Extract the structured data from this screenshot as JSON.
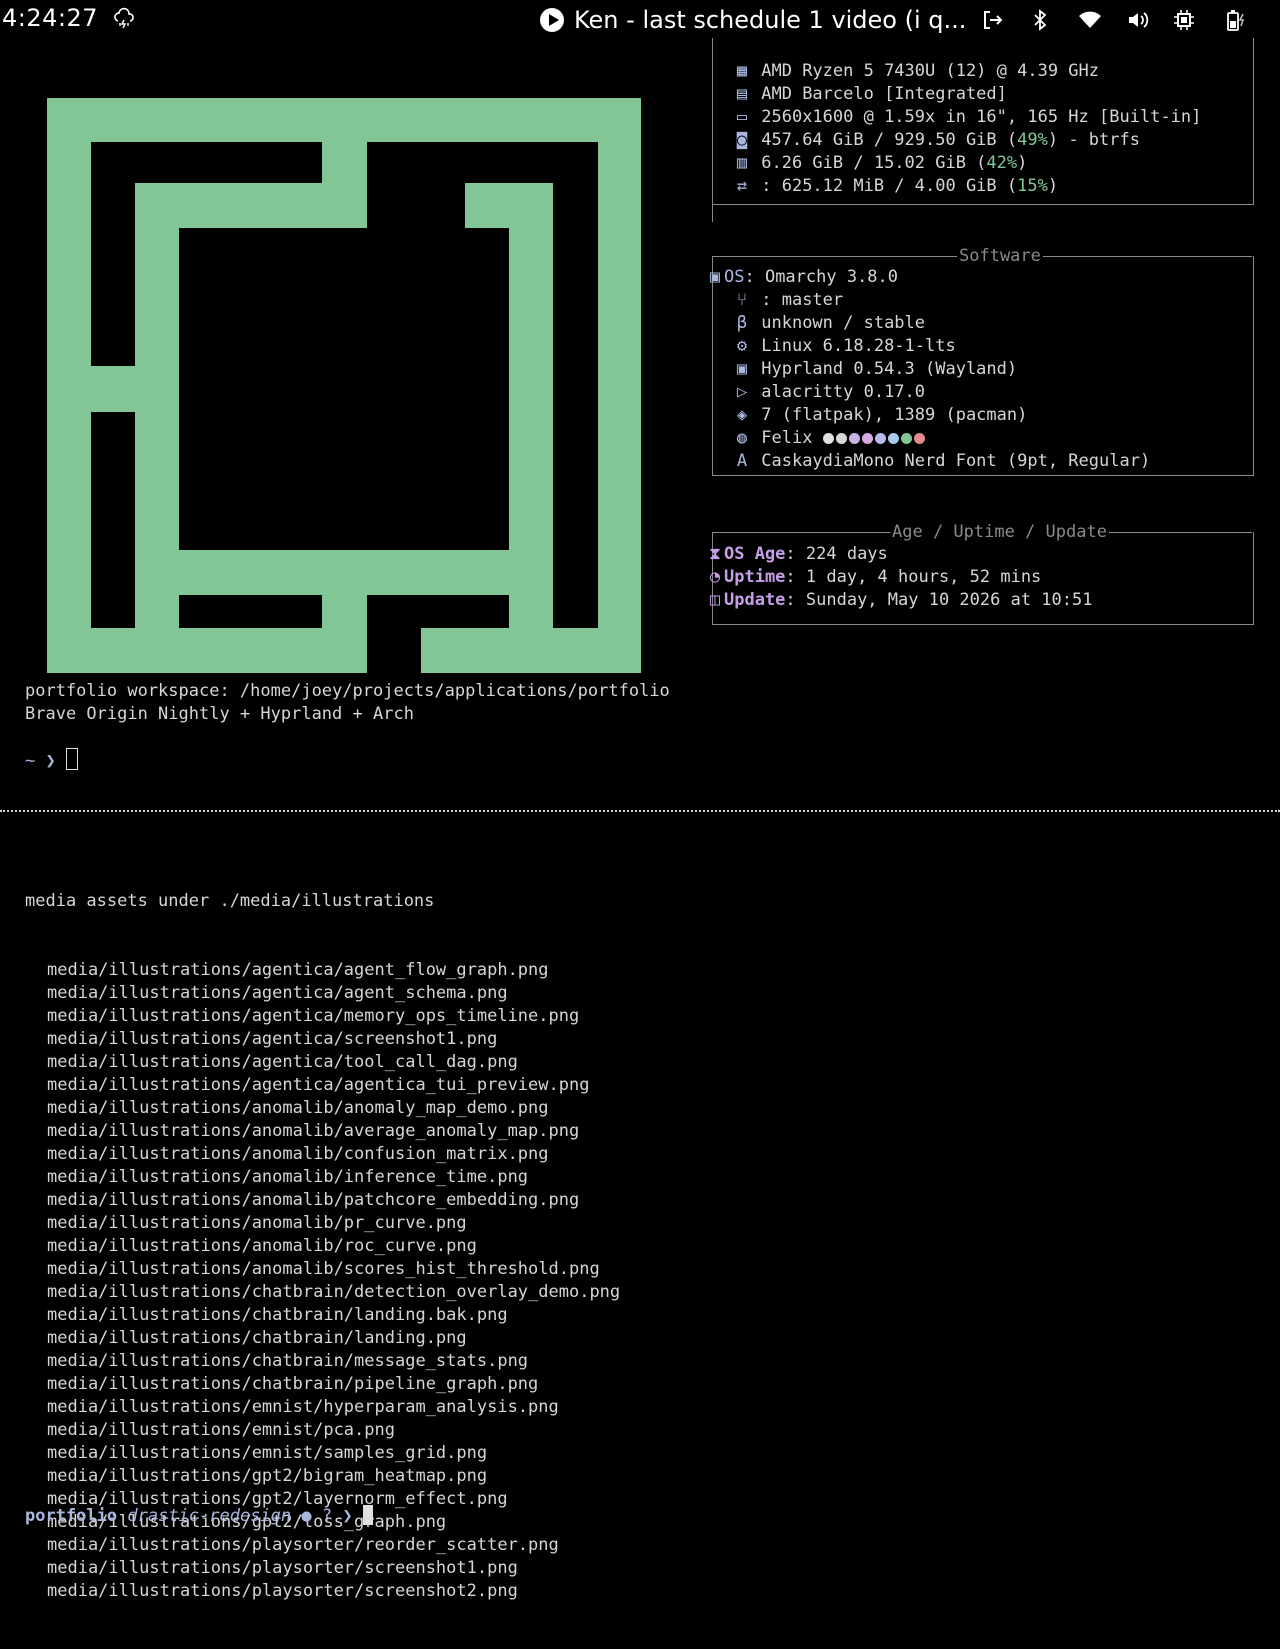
{
  "topbar": {
    "clock": "4:24:27",
    "media_title": "Ken - last schedule 1 video (i q..."
  },
  "hardware": {
    "rows": [
      {
        "icon": "cpu-icon",
        "text": "AMD Ryzen 5 7430U (12) @ 4.39 GHz"
      },
      {
        "icon": "gpu-icon",
        "text": "AMD Barcelo [Integrated]"
      },
      {
        "icon": "display-icon",
        "text": "2560x1600 @ 1.59x in 16\", 165 Hz [Built-in]"
      },
      {
        "icon": "disk-icon",
        "pre": "457.64 GiB / 929.50 GiB (",
        "pct": "49%",
        "post": ") - btrfs"
      },
      {
        "icon": "memory-icon",
        "pre": "6.26 GiB / 15.02 GiB (",
        "pct": "42%",
        "post": ")"
      },
      {
        "icon": "swap-icon",
        "pre": ": 625.12 MiB / 4.00 GiB (",
        "pct": "15%",
        "post": ")"
      }
    ]
  },
  "software": {
    "header": "Software",
    "os_label": "OS",
    "os_value": ": Omarchy 3.8.0",
    "rows": [
      {
        "icon": "git-branch-icon",
        "text": ": master"
      },
      {
        "icon": "bootloader-icon",
        "text": "unknown / stable"
      },
      {
        "icon": "kernel-gear-icon",
        "text": "Linux 6.18.28-1-lts"
      },
      {
        "icon": "window-manager-icon",
        "text": "Hyprland 0.54.3 (Wayland)"
      },
      {
        "icon": "terminal-icon",
        "text": "alacritty 0.17.0"
      },
      {
        "icon": "package-icon",
        "text": "7 (flatpak), 1389 (pacman)"
      },
      {
        "icon": "palette-icon",
        "text": "Felix"
      },
      {
        "icon": "font-icon",
        "text": "CaskaydiaMono Nerd Font (9pt, Regular)"
      }
    ],
    "palette_colors": [
      "#e0e0e0",
      "#d8d8d8",
      "#c9b4e6",
      "#d9a9e6",
      "#b9b9ef",
      "#a9c9ef",
      "#82c596",
      "#e38a8a"
    ]
  },
  "age": {
    "header": "Age / Uptime / Update",
    "rows": [
      {
        "icon": "hourglass-icon",
        "label": "OS Age",
        "value": ": 224 days"
      },
      {
        "icon": "uptime-icon",
        "label": "Uptime",
        "value": ": 1 day, 4 hours, 52 mins"
      },
      {
        "icon": "update-box-icon",
        "label": "Update",
        "value": ": Sunday, May 10 2026 at 10:51"
      }
    ]
  },
  "term1": {
    "line1": "portfolio workspace: /home/joey/projects/applications/portfolio",
    "line2": "Brave Origin Nightly + Hyprland + Arch",
    "prompt": "~ ❯ "
  },
  "term2": {
    "heading": "media assets under ./media/illustrations",
    "files": [
      "media/illustrations/agentica/agent_flow_graph.png",
      "media/illustrations/agentica/agent_schema.png",
      "media/illustrations/agentica/memory_ops_timeline.png",
      "media/illustrations/agentica/screenshot1.png",
      "media/illustrations/agentica/tool_call_dag.png",
      "media/illustrations/agentica/agentica_tui_preview.png",
      "media/illustrations/anomalib/anomaly_map_demo.png",
      "media/illustrations/anomalib/average_anomaly_map.png",
      "media/illustrations/anomalib/confusion_matrix.png",
      "media/illustrations/anomalib/inference_time.png",
      "media/illustrations/anomalib/patchcore_embedding.png",
      "media/illustrations/anomalib/pr_curve.png",
      "media/illustrations/anomalib/roc_curve.png",
      "media/illustrations/anomalib/scores_hist_threshold.png",
      "media/illustrations/chatbrain/detection_overlay_demo.png",
      "media/illustrations/chatbrain/landing.bak.png",
      "media/illustrations/chatbrain/landing.png",
      "media/illustrations/chatbrain/message_stats.png",
      "media/illustrations/chatbrain/pipeline_graph.png",
      "media/illustrations/emnist/hyperparam_analysis.png",
      "media/illustrations/emnist/pca.png",
      "media/illustrations/emnist/samples_grid.png",
      "media/illustrations/gpt2/bigram_heatmap.png",
      "media/illustrations/gpt2/layernorm_effect.png",
      "media/illustrations/gpt2/loss_graph.png",
      "media/illustrations/playsorter/reorder_scatter.png",
      "media/illustrations/playsorter/screenshot1.png",
      "media/illustrations/playsorter/screenshot2.png"
    ],
    "prompt_dir": "portfolio",
    "prompt_branch": "drastic-redesign",
    "prompt_rest": " ● ? ❯ "
  }
}
